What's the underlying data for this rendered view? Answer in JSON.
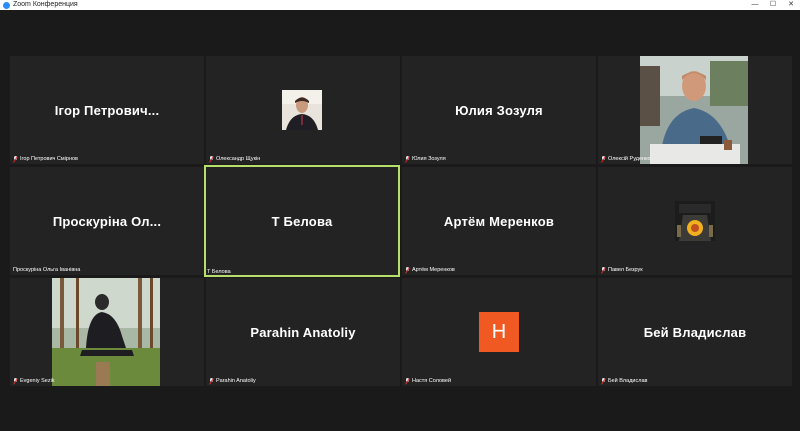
{
  "window": {
    "title": "Zoom Конференция",
    "controls": {
      "minimize": "—",
      "maximize": "☐",
      "close": "✕"
    }
  },
  "colors": {
    "tile_bg": "#232323",
    "active_border": "#b6e06a",
    "h_avatar_bg": "#f05a22"
  },
  "participants": [
    {
      "display": "Ігор Петрович...",
      "label": "Ігор Петрович Смірнов",
      "muted": true
    },
    {
      "display": "",
      "label": "Олександр Щукін",
      "muted": true
    },
    {
      "display": "Юлия Зозуля",
      "label": "Юлия Зозуля",
      "muted": true
    },
    {
      "display": "",
      "label": "Олексій Руденко",
      "muted": true
    },
    {
      "display": "Проскуріна Ол...",
      "label": "Проскуріна Ольга Іванівна",
      "muted": false
    },
    {
      "display": "Т Белова",
      "label": "Т Белова",
      "muted": false,
      "active": true
    },
    {
      "display": "Артём Меренков",
      "label": "Артём Меренков",
      "muted": true
    },
    {
      "display": "",
      "label": "Павел Безрук",
      "muted": true
    },
    {
      "display": "",
      "label": "Evgeniy Sezik",
      "muted": true
    },
    {
      "display": "Parahin Anatoliy",
      "label": "Parahin Anatoliy",
      "muted": true
    },
    {
      "display": "",
      "label": "Настя Соловей",
      "muted": true,
      "avatar_letter": "H"
    },
    {
      "display": "Бей Владислав",
      "label": "Бей Владислав",
      "muted": true
    }
  ]
}
